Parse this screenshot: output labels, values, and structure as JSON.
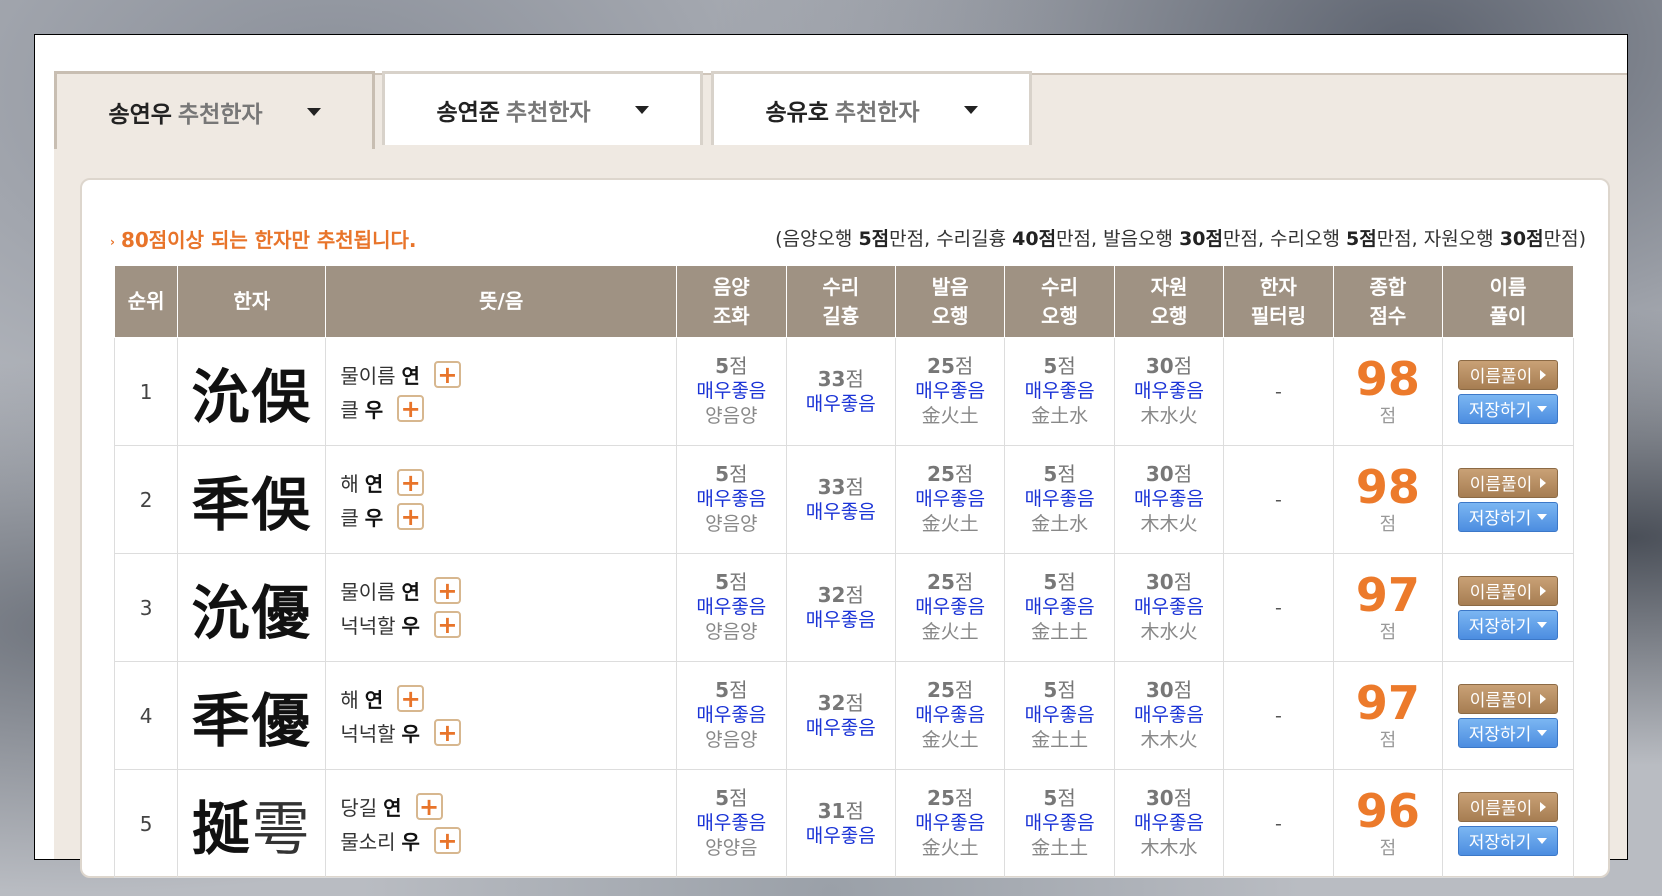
{
  "tabs": [
    {
      "name": "송연우",
      "suffix": "추천한자"
    },
    {
      "name": "송연준",
      "suffix": "추천한자"
    },
    {
      "name": "송유호",
      "suffix": "추천한자"
    }
  ],
  "notice": "80점이상 되는 한자만 추천됩니다.",
  "legend": {
    "open": "(음양오행 ",
    "s1": "5점",
    "t1": "만점, 수리길흉 ",
    "s2": "40점",
    "t2": "만점, 발음오행 ",
    "s3": "30점",
    "t3": "만점, 수리오행 ",
    "s4": "5점",
    "t4": "만점, 자원오행 ",
    "s5": "30점",
    "t5": "만점)"
  },
  "headers": {
    "rank": "순위",
    "hanja": "한자",
    "meaning": "뜻/음",
    "c1a": "음양",
    "c1b": "조화",
    "c2a": "수리",
    "c2b": "길흉",
    "c3a": "발음",
    "c3b": "오행",
    "c4a": "수리",
    "c4b": "오행",
    "c5a": "자원",
    "c5b": "오행",
    "c6a": "한자",
    "c6b": "필터링",
    "c7a": "종합",
    "c7b": "점수",
    "c8a": "이름",
    "c8b": "풀이"
  },
  "unit": "점",
  "good": "매우좋음",
  "dash": "-",
  "buttons": {
    "detail": "이름풀이",
    "save": "저장하기"
  },
  "rows": [
    {
      "rank": "1",
      "h1": "沇",
      "h2": "俁",
      "m1": "물이름",
      "r1": "연",
      "m2": "클",
      "r2": "우",
      "s1": "5",
      "s2": "33",
      "s3": "25",
      "s4": "5",
      "s5": "30",
      "e1": "양음양",
      "e3": "金火土",
      "e4": "金土水",
      "e5": "木水火",
      "total": "98"
    },
    {
      "rank": "2",
      "h1": "秊",
      "h2": "俁",
      "m1": "해",
      "r1": "연",
      "m2": "클",
      "r2": "우",
      "s1": "5",
      "s2": "33",
      "s3": "25",
      "s4": "5",
      "s5": "30",
      "e1": "양음양",
      "e3": "金火土",
      "e4": "金土水",
      "e5": "木木火",
      "total": "98"
    },
    {
      "rank": "3",
      "h1": "沇",
      "h2": "優",
      "m1": "물이름",
      "r1": "연",
      "m2": "넉넉할",
      "r2": "우",
      "s1": "5",
      "s2": "32",
      "s3": "25",
      "s4": "5",
      "s5": "30",
      "e1": "양음양",
      "e3": "金火土",
      "e4": "金土土",
      "e5": "木水火",
      "total": "97"
    },
    {
      "rank": "4",
      "h1": "秊",
      "h2": "優",
      "m1": "해",
      "r1": "연",
      "m2": "넉넉할",
      "r2": "우",
      "s1": "5",
      "s2": "32",
      "s3": "25",
      "s4": "5",
      "s5": "30",
      "e1": "양음양",
      "e3": "金火土",
      "e4": "金土土",
      "e5": "木木火",
      "total": "97"
    },
    {
      "rank": "5",
      "h1": "挻",
      "h2": "雩",
      "m1": "당길",
      "r1": "연",
      "m2": "물소리",
      "r2": "우",
      "s1": "5",
      "s2": "31",
      "s3": "25",
      "s4": "5",
      "s5": "30",
      "e1": "양양음",
      "e3": "金火土",
      "e4": "金土土",
      "e5": "木木水",
      "total": "96"
    }
  ]
}
